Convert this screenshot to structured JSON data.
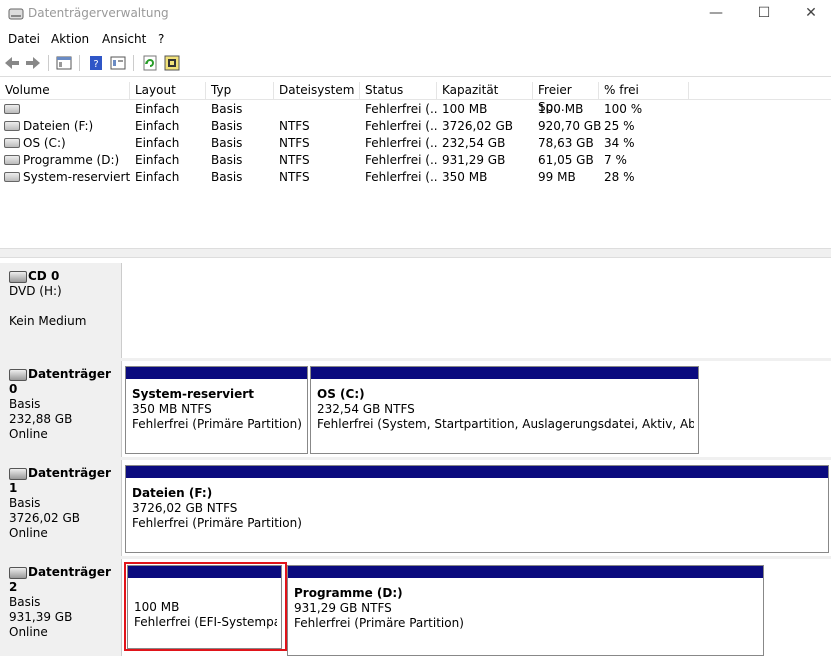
{
  "window": {
    "title": "Datenträgerverwaltung"
  },
  "menu": [
    "Datei",
    "Aktion",
    "Ansicht",
    "?"
  ],
  "volume_table": {
    "columns": [
      "Volume",
      "Layout",
      "Typ",
      "Dateisystem",
      "Status",
      "Kapazität",
      "Freier Sp...",
      "% frei"
    ],
    "rows": [
      [
        "",
        "Einfach",
        "Basis",
        "",
        "Fehlerfrei (...",
        "100 MB",
        "100 MB",
        "100 %"
      ],
      [
        "Dateien (F:)",
        "Einfach",
        "Basis",
        "NTFS",
        "Fehlerfrei (...",
        "3726,02 GB",
        "920,70 GB",
        "25 %"
      ],
      [
        "OS (C:)",
        "Einfach",
        "Basis",
        "NTFS",
        "Fehlerfrei (...",
        "232,54 GB",
        "78,63 GB",
        "34 %"
      ],
      [
        "Programme (D:)",
        "Einfach",
        "Basis",
        "NTFS",
        "Fehlerfrei (...",
        "931,29 GB",
        "61,05 GB",
        "7 %"
      ],
      [
        "System-reserviert",
        "Einfach",
        "Basis",
        "NTFS",
        "Fehlerfrei (...",
        "350 MB",
        "99 MB",
        "28 %"
      ]
    ]
  },
  "disks": [
    {
      "name": "CD 0",
      "type": "DVD (H:)",
      "size": "",
      "state": "Kein Medium"
    },
    {
      "name": "Datenträger 0",
      "type": "Basis",
      "size": "232,88 GB",
      "state": "Online",
      "partitions": [
        {
          "name": "System-reserviert",
          "size": "350 MB NTFS",
          "status": "Fehlerfrei (Primäre Partition)"
        },
        {
          "name": "OS  (C:)",
          "size": "232,54 GB NTFS",
          "status": "Fehlerfrei (System, Startpartition, Auslagerungsdatei, Aktiv, Absturzabbi"
        }
      ]
    },
    {
      "name": "Datenträger 1",
      "type": "Basis",
      "size": "3726,02 GB",
      "state": "Online",
      "partitions": [
        {
          "name": "Dateien  (F:)",
          "size": "3726,02 GB NTFS",
          "status": "Fehlerfrei (Primäre Partition)"
        }
      ]
    },
    {
      "name": "Datenträger 2",
      "type": "Basis",
      "size": "931,39 GB",
      "state": "Online",
      "partitions": [
        {
          "name": "",
          "size": "100 MB",
          "status": "Fehlerfrei (EFI-Systempartiti"
        },
        {
          "name": "Programme  (D:)",
          "size": "931,29 GB NTFS",
          "status": "Fehlerfrei (Primäre Partition)"
        }
      ]
    }
  ],
  "colors": {
    "partition_bar": "#0a0a7e",
    "highlight": "#e0141a"
  }
}
